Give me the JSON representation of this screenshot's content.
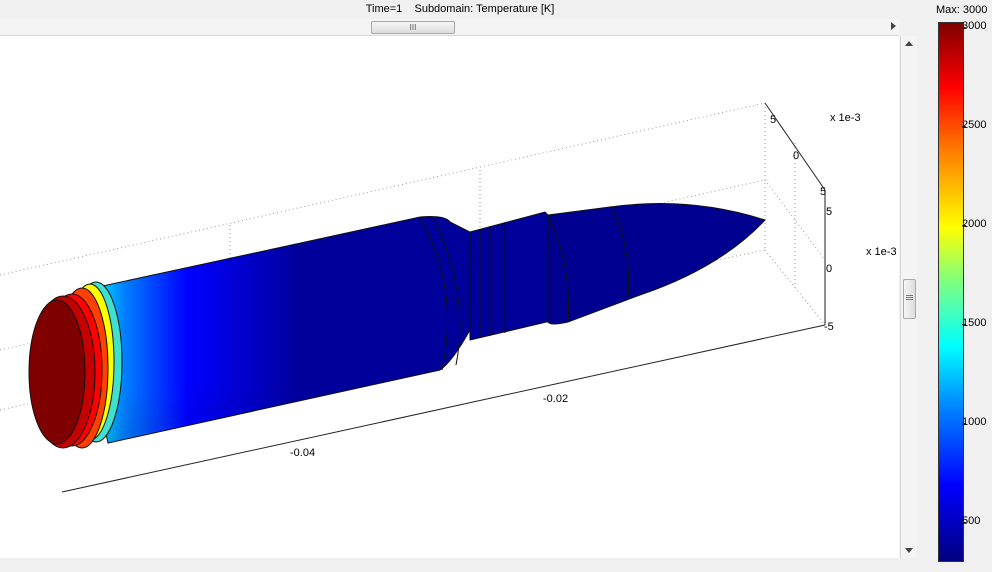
{
  "title": "Time=1    Subdomain: Temperature [K]",
  "colorbar": {
    "max_label": "Max: 3000",
    "ticks": [
      "3000",
      "2500",
      "2000",
      "1500",
      "1000",
      "500"
    ]
  },
  "axes": {
    "x_ticks": [
      "-0.04",
      "-0.02"
    ],
    "z_scale": "x 1e-3",
    "y_scale": "x 1e-3",
    "z_ticks": [
      "5",
      "0",
      "5"
    ],
    "y_ticks": [
      "5",
      "0",
      "-5"
    ]
  },
  "scrollbar": {
    "thumb_glyph": "III"
  },
  "colors": {
    "cold": "#00007f",
    "hot": "#7f0000"
  }
}
